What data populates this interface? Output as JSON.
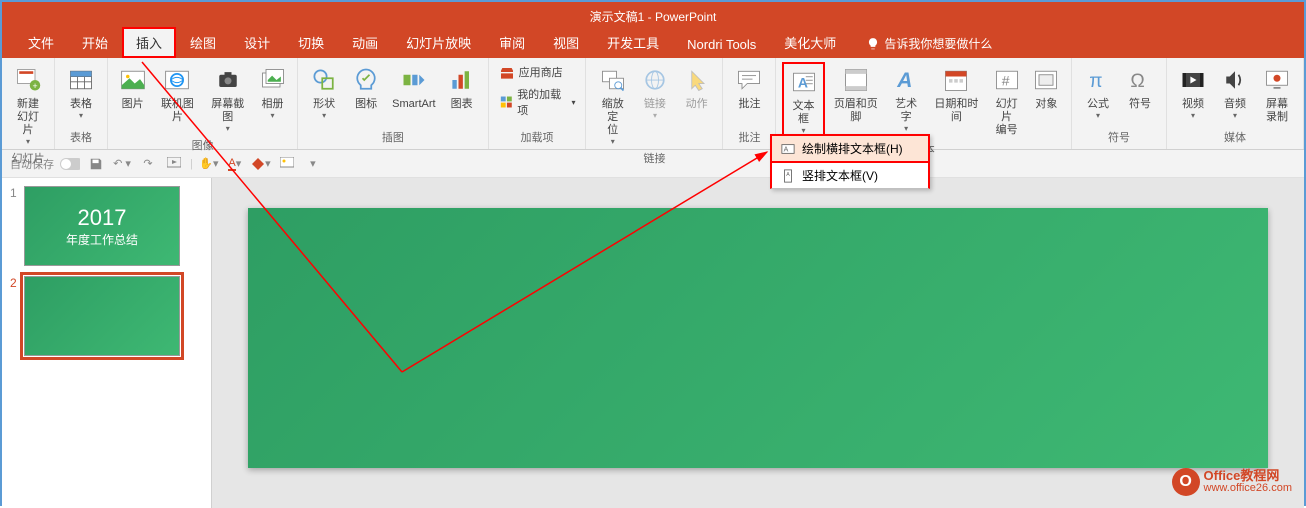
{
  "title": "演示文稿1 - PowerPoint",
  "tabs": {
    "file": "文件",
    "home": "开始",
    "insert": "插入",
    "draw": "绘图",
    "design": "设计",
    "transitions": "切换",
    "animations": "动画",
    "slideshow": "幻灯片放映",
    "review": "审阅",
    "view": "视图",
    "developer": "开发工具",
    "nordri": "Nordri Tools",
    "beautify": "美化大师"
  },
  "tell_me": "告诉我你想要做什么",
  "ribbon": {
    "new_slide": "新建\n幻灯片",
    "slides_group": "幻灯片",
    "table": "表格",
    "tables_group": "表格",
    "picture": "图片",
    "online_pic": "联机图片",
    "screenshot": "屏幕截图",
    "album": "相册",
    "images_group": "图像",
    "shapes": "形状",
    "icons": "图标",
    "smartart": "SmartArt",
    "chart": "图表",
    "illustrations_group": "插图",
    "store": "应用商店",
    "myaddins": "我的加载项",
    "addins_group": "加载项",
    "zoom": "缩放定\n位",
    "link": "链接",
    "action": "动作",
    "links_group": "链接",
    "comment": "批注",
    "comments_group": "批注",
    "textbox": "文本框",
    "headerfooter": "页眉和页脚",
    "wordart": "艺术字",
    "datetime": "日期和时间",
    "slidenumber": "幻灯片\n编号",
    "object": "对象",
    "text_group": "文本",
    "equation": "公式",
    "symbol": "符号",
    "symbols_group": "符号",
    "video": "视频",
    "audio": "音频",
    "screenrec": "屏幕\n录制",
    "media_group": "媒体"
  },
  "dropdown": {
    "horizontal": "绘制横排文本框(H)",
    "vertical": "竖排文本框(V)"
  },
  "qat": {
    "autosave": "自动保存"
  },
  "slides": [
    {
      "num": "1",
      "year": "2017",
      "subtitle": "年度工作总结"
    },
    {
      "num": "2",
      "year": "",
      "subtitle": ""
    }
  ],
  "watermark": {
    "logo": "O",
    "line1": "Office教程网",
    "line2": "www.office26.com"
  }
}
